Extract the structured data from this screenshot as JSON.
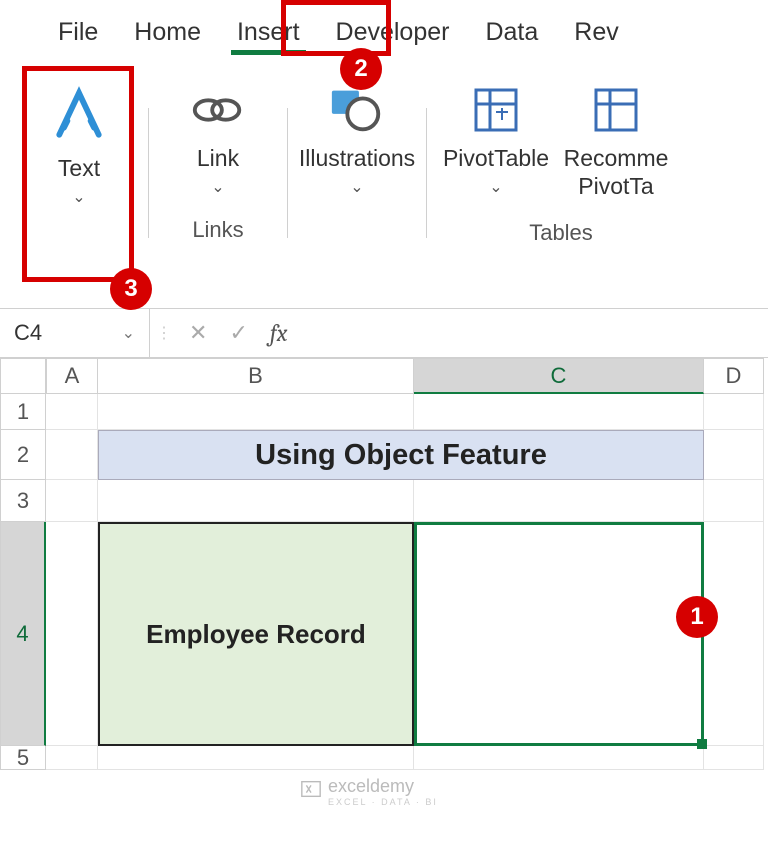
{
  "tabs": {
    "file": "File",
    "home": "Home",
    "insert": "Insert",
    "developer": "Developer",
    "data": "Data",
    "review": "Rev"
  },
  "ribbon": {
    "text": {
      "label": "Text"
    },
    "link": {
      "label": "Link",
      "group": "Links"
    },
    "illustrations": {
      "label": "Illustrations"
    },
    "pivot": {
      "label": "PivotTable"
    },
    "recommended": {
      "label_line1": "Recomme",
      "label_line2": "PivotTa"
    },
    "tables_group": "Tables"
  },
  "formula_bar": {
    "name_box": "C4",
    "fx": "fx",
    "value": ""
  },
  "columns": {
    "a": "A",
    "b": "B",
    "c": "C",
    "d": "D"
  },
  "rows": {
    "r1": "1",
    "r2": "2",
    "r3": "3",
    "r4": "4",
    "r5": "5"
  },
  "sheet": {
    "title": "Using Object Feature",
    "employee_label": "Employee Record"
  },
  "badges": {
    "b1": "1",
    "b2": "2",
    "b3": "3"
  },
  "watermark": {
    "brand": "exceldemy",
    "tag": "EXCEL · DATA · BI"
  }
}
